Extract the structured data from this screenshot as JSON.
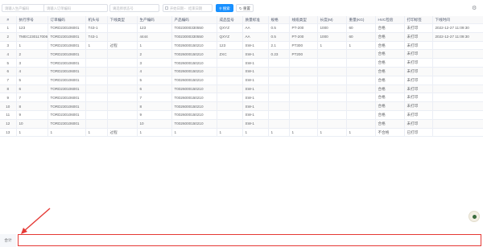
{
  "filters": {
    "production_order_placeholder": "请输入生产编码",
    "order_no_placeholder": "请输入订单编码",
    "material_placeholder": "请选择状态号",
    "date_start_placeholder": "开始日期",
    "date_sep": "-",
    "date_end_placeholder": "结束日期",
    "search_label": "搜索",
    "reset_label": "重置"
  },
  "table": {
    "headers": [
      "#",
      "执行序号",
      "订单编码",
      "机头号",
      "下线类型",
      "生产编码",
      "产品编码",
      "成品型号",
      "质量标准",
      "规格",
      "线缆类型",
      "长度(M)",
      "重量(KG)",
      "HVC检验",
      "打印标签",
      "下线时间"
    ],
    "rows": [
      [
        "1",
        "123",
        "TORD230106001",
        "T43-1",
        "",
        "123",
        "T0023000330550",
        "QXYZ",
        "AA",
        "0.5",
        "PT-200",
        "1000",
        "60",
        "合格",
        "未打印",
        "2022-12-27 11:09:30"
      ],
      [
        "2",
        "TMEC230117006",
        "TORD230106001",
        "T43-1",
        "",
        "4444",
        "T0023000330550",
        "QXYZ",
        "AA",
        "0.5",
        "PT-200",
        "1000",
        "60",
        "合格",
        "未打印",
        "2022-12-27 11:09:30"
      ],
      [
        "3",
        "1",
        "TORD230106001",
        "1",
        "过程",
        "1",
        "T0026000150210",
        "123",
        "SW-1",
        "2.1",
        "PT300",
        "1",
        "1",
        "合格",
        "未打印",
        ""
      ],
      [
        "4",
        "2",
        "TORD230106001",
        "",
        "",
        "2",
        "T0026000150210",
        "ZXC",
        "SW-1",
        "0.23",
        "PT200",
        "",
        "",
        "合格",
        "未打印",
        ""
      ],
      [
        "5",
        "3",
        "TORD230106001",
        "",
        "",
        "3",
        "T0026000150210",
        "",
        "SW-1",
        "",
        "",
        "",
        "",
        "合格",
        "未打印",
        ""
      ],
      [
        "6",
        "4",
        "TORD230106001",
        "",
        "",
        "4",
        "T0026000150210",
        "",
        "SW-1",
        "",
        "",
        "",
        "",
        "合格",
        "未打印",
        ""
      ],
      [
        "7",
        "5",
        "TORD230106001",
        "",
        "",
        "5",
        "T0026000150210",
        "",
        "SW-1",
        "",
        "",
        "",
        "",
        "合格",
        "未打印",
        ""
      ],
      [
        "8",
        "6",
        "TORD230106001",
        "",
        "",
        "6",
        "T0026000150210",
        "",
        "SW-1",
        "",
        "",
        "",
        "",
        "合格",
        "未打印",
        ""
      ],
      [
        "9",
        "7",
        "TORD230106001",
        "",
        "",
        "7",
        "T0026000150210",
        "",
        "SW-1",
        "",
        "",
        "",
        "",
        "合格",
        "未打印",
        ""
      ],
      [
        "10",
        "8",
        "TORD230106001",
        "",
        "",
        "8",
        "T0026000150210",
        "",
        "SW-1",
        "",
        "",
        "",
        "",
        "合格",
        "未打印",
        ""
      ],
      [
        "11",
        "9",
        "TORD230106001",
        "",
        "",
        "9",
        "T0026000150210",
        "",
        "SW-1",
        "",
        "",
        "",
        "",
        "合格",
        "未打印",
        ""
      ],
      [
        "12",
        "10",
        "TORD230106001",
        "",
        "",
        "10",
        "T0026000150210",
        "",
        "SW-1",
        "",
        "",
        "",
        "",
        "合格",
        "未打印",
        ""
      ],
      [
        "13",
        "1",
        "1",
        "1",
        "过程",
        "1",
        "1",
        "1",
        "1",
        "1",
        "1",
        "1",
        "1",
        "不合格",
        "已打印",
        ""
      ]
    ]
  },
  "footer": {
    "total_label": "合计"
  },
  "icons": {
    "search": "search-icon",
    "reset": "refresh-icon",
    "settings": "gear-icon",
    "calendar": "calendar-icon",
    "floating": "assistant-icon"
  },
  "colors": {
    "primary": "#1890ff",
    "highlight": "#e53935"
  }
}
